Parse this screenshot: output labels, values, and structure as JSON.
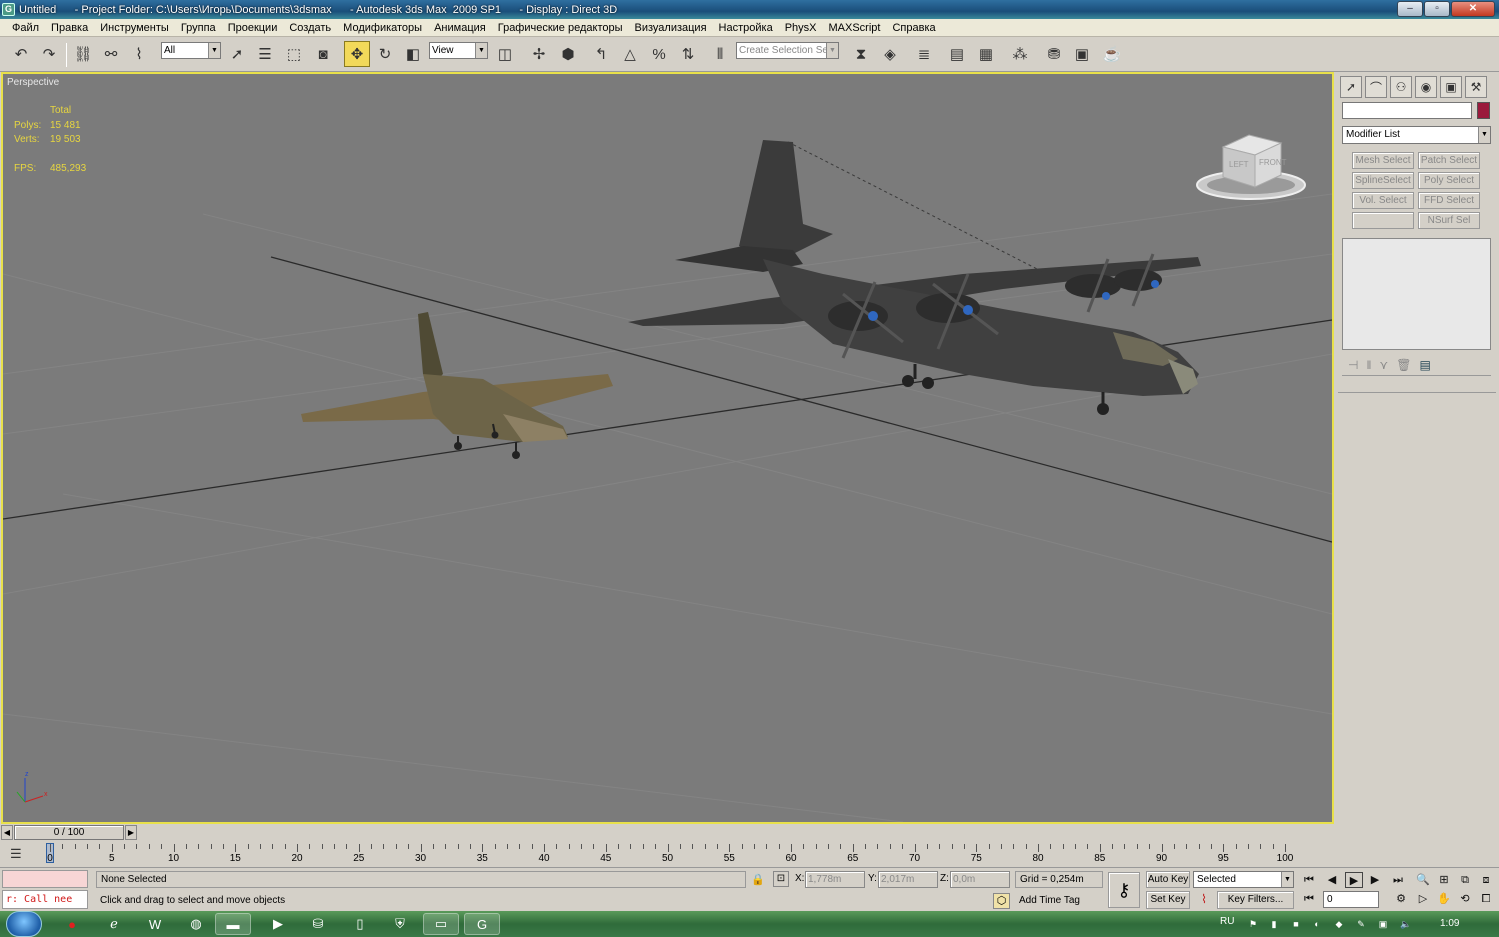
{
  "titlebar": {
    "title": "Untitled      - Project Folder: C:\\Users\\Игорь\\Documents\\3dsmax      - Autodesk 3ds Max  2009 SP1      - Display : Direct 3D",
    "app_icon": "3dsmax-icon",
    "buttons": [
      "minimize",
      "maximize",
      "close"
    ]
  },
  "menu": {
    "items": [
      "Файл",
      "Правка",
      "Инструменты",
      "Группа",
      "Проекции",
      "Создать",
      "Модификаторы",
      "Анимация",
      "Графические редакторы",
      "Визуализация",
      "Настройка",
      "PhysX",
      "MAXScript",
      "Справка"
    ]
  },
  "toolbar": {
    "selection_filter": "All",
    "reference_coord": "View",
    "named_selection_placeholder": "Create Selection Set"
  },
  "viewport": {
    "label": "Perspective",
    "stats": {
      "header": "Total",
      "polys_label": "Polys:",
      "polys_value": "15 481",
      "verts_label": "Verts:",
      "verts_value": "19 503",
      "fps_label": "FPS:",
      "fps_value": "485,293"
    },
    "viewcube": {
      "left_face": "LEFT",
      "front_face": "FRONT"
    },
    "accent_color": "#e8e04a",
    "background_color": "#7b7b7b"
  },
  "command_panel": {
    "modifier_list": "Modifier List",
    "object_color": "#9a1a3c",
    "modifier_buttons": [
      "Mesh Select",
      "Patch Select",
      "SplineSelect",
      "Poly Select",
      "Vol. Select",
      "FFD Select",
      "",
      "NSurf Sel"
    ]
  },
  "timeline": {
    "frame_display": "0 / 100",
    "ticks": [
      "0",
      "5",
      "10",
      "15",
      "20",
      "25",
      "30",
      "35",
      "40",
      "45",
      "50",
      "55",
      "60",
      "65",
      "70",
      "75",
      "80",
      "85",
      "90",
      "95",
      "100"
    ]
  },
  "status": {
    "maxscript_listener": "r: Call nee",
    "selection": "None Selected",
    "prompt": "Click and drag to select and move objects",
    "x_label": "X:",
    "x_value": "1,778m",
    "y_label": "Y:",
    "y_value": "2,017m",
    "z_label": "Z:",
    "z_value": "0,0m",
    "grid": "Grid = 0,254m",
    "add_time_tag": "Add Time Tag",
    "auto_key": "Auto Key",
    "set_key": "Set Key",
    "key_mode": "Selected",
    "key_filters": "Key Filters...",
    "current_frame": "0"
  },
  "taskbar": {
    "language": "RU",
    "clock": "1:09"
  }
}
